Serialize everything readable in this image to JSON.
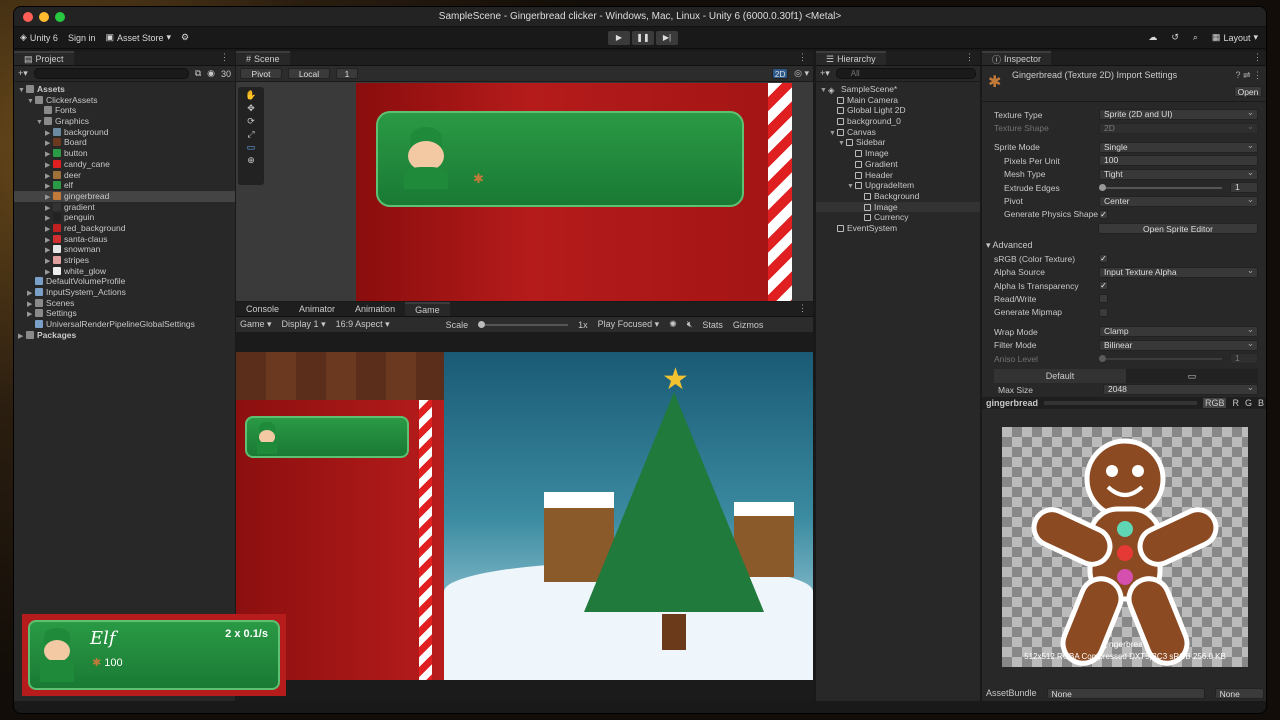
{
  "window_title": "SampleScene - Gingerbread clicker - Windows, Mac, Linux - Unity 6 (6000.0.30f1) <Metal>",
  "toolbar": {
    "account": "Unity 6",
    "sign_in": "Sign in",
    "asset_store": "Asset Store",
    "layout": "Layout"
  },
  "project": {
    "tab": "Project",
    "count": "30",
    "items": [
      {
        "label": "Assets",
        "depth": 0,
        "arrow": "▼",
        "icon": "folder",
        "bold": true
      },
      {
        "label": "ClickerAssets",
        "depth": 1,
        "arrow": "▼",
        "icon": "folder"
      },
      {
        "label": "Fonts",
        "depth": 2,
        "arrow": "",
        "icon": "folder"
      },
      {
        "label": "Graphics",
        "depth": 2,
        "arrow": "▼",
        "icon": "folder"
      },
      {
        "label": "background",
        "depth": 3,
        "arrow": "▶",
        "icon": "img-bg"
      },
      {
        "label": "Board",
        "depth": 3,
        "arrow": "▶",
        "icon": "img-board"
      },
      {
        "label": "button",
        "depth": 3,
        "arrow": "▶",
        "icon": "img-button"
      },
      {
        "label": "candy_cane",
        "depth": 3,
        "arrow": "▶",
        "icon": "img-candy"
      },
      {
        "label": "deer",
        "depth": 3,
        "arrow": "▶",
        "icon": "img-deer"
      },
      {
        "label": "elf",
        "depth": 3,
        "arrow": "▶",
        "icon": "img-elf"
      },
      {
        "label": "gingerbread",
        "depth": 3,
        "arrow": "▶",
        "icon": "img-ginger",
        "selected": true
      },
      {
        "label": "gradient",
        "depth": 3,
        "arrow": "▶",
        "icon": "img-gradient"
      },
      {
        "label": "penguin",
        "depth": 3,
        "arrow": "▶",
        "icon": "img-penguin"
      },
      {
        "label": "red_background",
        "depth": 3,
        "arrow": "▶",
        "icon": "img-red"
      },
      {
        "label": "santa-claus",
        "depth": 3,
        "arrow": "▶",
        "icon": "img-santa"
      },
      {
        "label": "snowman",
        "depth": 3,
        "arrow": "▶",
        "icon": "img-snowman"
      },
      {
        "label": "stripes",
        "depth": 3,
        "arrow": "▶",
        "icon": "img-stripes"
      },
      {
        "label": "white_glow",
        "depth": 3,
        "arrow": "▶",
        "icon": "img-glow"
      },
      {
        "label": "DefaultVolumeProfile",
        "depth": 1,
        "arrow": "",
        "icon": "asset"
      },
      {
        "label": "InputSystem_Actions",
        "depth": 1,
        "arrow": "▶",
        "icon": "asset"
      },
      {
        "label": "Scenes",
        "depth": 1,
        "arrow": "▶",
        "icon": "folder"
      },
      {
        "label": "Settings",
        "depth": 1,
        "arrow": "▶",
        "icon": "folder"
      },
      {
        "label": "UniversalRenderPipelineGlobalSettings",
        "depth": 1,
        "arrow": "",
        "icon": "asset"
      },
      {
        "label": "Packages",
        "depth": 0,
        "arrow": "▶",
        "icon": "folder",
        "bold": true
      }
    ]
  },
  "scene": {
    "tab": "Scene",
    "pivot": "Pivot",
    "local": "Local",
    "snap": "1",
    "mode2d": "2D"
  },
  "game": {
    "tabs": [
      "Console",
      "Animator",
      "Animation",
      "Game"
    ],
    "game_select": "Game",
    "display": "Display 1",
    "aspect": "16:9 Aspect",
    "scale_label": "Scale",
    "scale_value": "1x",
    "play_focused": "Play Focused",
    "stats": "Stats",
    "gizmos": "Gizmos"
  },
  "elf_card": {
    "name": "Elf",
    "rate": "2 x 0.1/s",
    "cost": "100"
  },
  "hierarchy": {
    "tab": "Hierarchy",
    "search": "All",
    "items": [
      {
        "label": "SampleScene*",
        "depth": 0,
        "arrow": "▼",
        "icon": "unity"
      },
      {
        "label": "Main Camera",
        "depth": 1,
        "arrow": "",
        "icon": "cube"
      },
      {
        "label": "Global Light 2D",
        "depth": 1,
        "arrow": "",
        "icon": "cube"
      },
      {
        "label": "background_0",
        "depth": 1,
        "arrow": "",
        "icon": "cube"
      },
      {
        "label": "Canvas",
        "depth": 1,
        "arrow": "▼",
        "icon": "cube"
      },
      {
        "label": "Sidebar",
        "depth": 2,
        "arrow": "▼",
        "icon": "cube"
      },
      {
        "label": "Image",
        "depth": 3,
        "arrow": "",
        "icon": "cube"
      },
      {
        "label": "Gradient",
        "depth": 3,
        "arrow": "",
        "icon": "cube"
      },
      {
        "label": "Header",
        "depth": 3,
        "arrow": "",
        "icon": "cube"
      },
      {
        "label": "UpgradeItem",
        "depth": 3,
        "arrow": "▼",
        "icon": "cube"
      },
      {
        "label": "Background",
        "depth": 4,
        "arrow": "",
        "icon": "cube"
      },
      {
        "label": "Image",
        "depth": 4,
        "arrow": "",
        "icon": "cube",
        "hover": true
      },
      {
        "label": "Currency",
        "depth": 4,
        "arrow": "",
        "icon": "cube"
      },
      {
        "label": "EventSystem",
        "depth": 1,
        "arrow": "",
        "icon": "cube"
      }
    ]
  },
  "inspector": {
    "tab": "Inspector",
    "title": "Gingerbread (Texture 2D) Import Settings",
    "open": "Open",
    "fields1": [
      {
        "label": "Texture Type",
        "value": "Sprite (2D and UI)",
        "dd": true
      },
      {
        "label": "Texture Shape",
        "value": "2D",
        "dd": true,
        "dim": true
      }
    ],
    "fields2": [
      {
        "label": "Sprite Mode",
        "value": "Single",
        "dd": true
      },
      {
        "label": "Pixels Per Unit",
        "value": "100",
        "indent": true
      },
      {
        "label": "Mesh Type",
        "value": "Tight",
        "dd": true,
        "indent": true
      },
      {
        "label": "Extrude Edges",
        "value": "1",
        "slider": true,
        "indent": true
      },
      {
        "label": "Pivot",
        "value": "Center",
        "dd": true,
        "indent": true
      },
      {
        "label": "Generate Physics Shape",
        "check": true,
        "indent": true
      }
    ],
    "open_sprite_editor": "Open Sprite Editor",
    "advanced": "Advanced",
    "fields3": [
      {
        "label": "sRGB (Color Texture)",
        "check": true
      },
      {
        "label": "Alpha Source",
        "value": "Input Texture Alpha",
        "dd": true
      },
      {
        "label": "Alpha Is Transparency",
        "check": true
      },
      {
        "label": "Read/Write",
        "check": false
      },
      {
        "label": "Generate Mipmap",
        "check": false
      }
    ],
    "fields4": [
      {
        "label": "Wrap Mode",
        "value": "Clamp",
        "dd": true
      },
      {
        "label": "Filter Mode",
        "value": "Bilinear",
        "dd": true
      },
      {
        "label": "Aniso Level",
        "value": "1",
        "slider": true,
        "dim": true
      }
    ],
    "platform_default": "Default",
    "max_size_label": "Max Size",
    "max_size_value": "2048",
    "preview_name": "gingerbread",
    "channels": [
      "RGB",
      "R",
      "G",
      "B"
    ],
    "preview_caption": "gingerbread",
    "preview_info": "512x512  RGBA Compressed DXT5|BC3 sRGB  256.0 KB",
    "asset_bundle_label": "AssetBundle",
    "asset_bundle_value": "None",
    "asset_bundle_variant": "None"
  }
}
